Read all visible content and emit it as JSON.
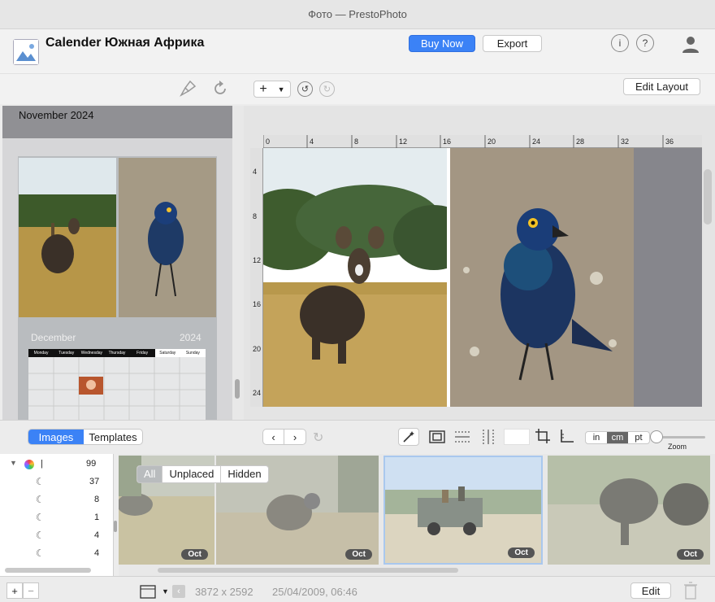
{
  "window": {
    "title": "Фото — PrestoPhoto"
  },
  "header": {
    "document_title": "Calender Южная Африка",
    "buy_now": "Buy Now",
    "export": "Export",
    "info_symbol": "i",
    "help_symbol": "?"
  },
  "toolbar": {
    "add_symbol": "+",
    "edit_layout": "Edit Layout"
  },
  "left_panel": {
    "month": "November 2024",
    "calendar": {
      "month": "December",
      "year": "2024",
      "weekdays": [
        "Monday",
        "Tuesday",
        "Wednesday",
        "Thursday",
        "Friday",
        "Saturday",
        "Sunday"
      ]
    }
  },
  "rulers": {
    "horizontal": [
      "0",
      "4",
      "8",
      "12",
      "16",
      "20",
      "24",
      "28",
      "32",
      "36"
    ],
    "vertical": [
      "4",
      "8",
      "12",
      "16",
      "20",
      "24"
    ]
  },
  "bottom_toolbar": {
    "tabs": [
      "Images",
      "Templates"
    ],
    "active_tab": "Images",
    "units": [
      "in",
      "cm",
      "pt"
    ],
    "active_unit": "cm",
    "zoom_label": "Zoom"
  },
  "tree": {
    "rows": [
      {
        "label": "|",
        "count": "99"
      },
      {
        "label": "",
        "count": "37"
      },
      {
        "label": "",
        "count": "8"
      },
      {
        "label": "",
        "count": "1"
      },
      {
        "label": "",
        "count": "4"
      },
      {
        "label": "",
        "count": "4"
      }
    ]
  },
  "filter": {
    "options": [
      "All",
      "Unplaced",
      "Hidden"
    ],
    "active": "All"
  },
  "thumbnails": [
    {
      "badge": "Oct"
    },
    {
      "badge": "Oct"
    },
    {
      "badge": "Oct"
    },
    {
      "badge": "Oct"
    }
  ],
  "footer": {
    "add_symbol": "+",
    "remove_symbol": "−",
    "dimensions": "3872 x 2592",
    "date": "25/04/2009, 06:46",
    "edit": "Edit"
  },
  "colors": {
    "accent": "#3b82f6",
    "panel_gray": "#909094"
  }
}
